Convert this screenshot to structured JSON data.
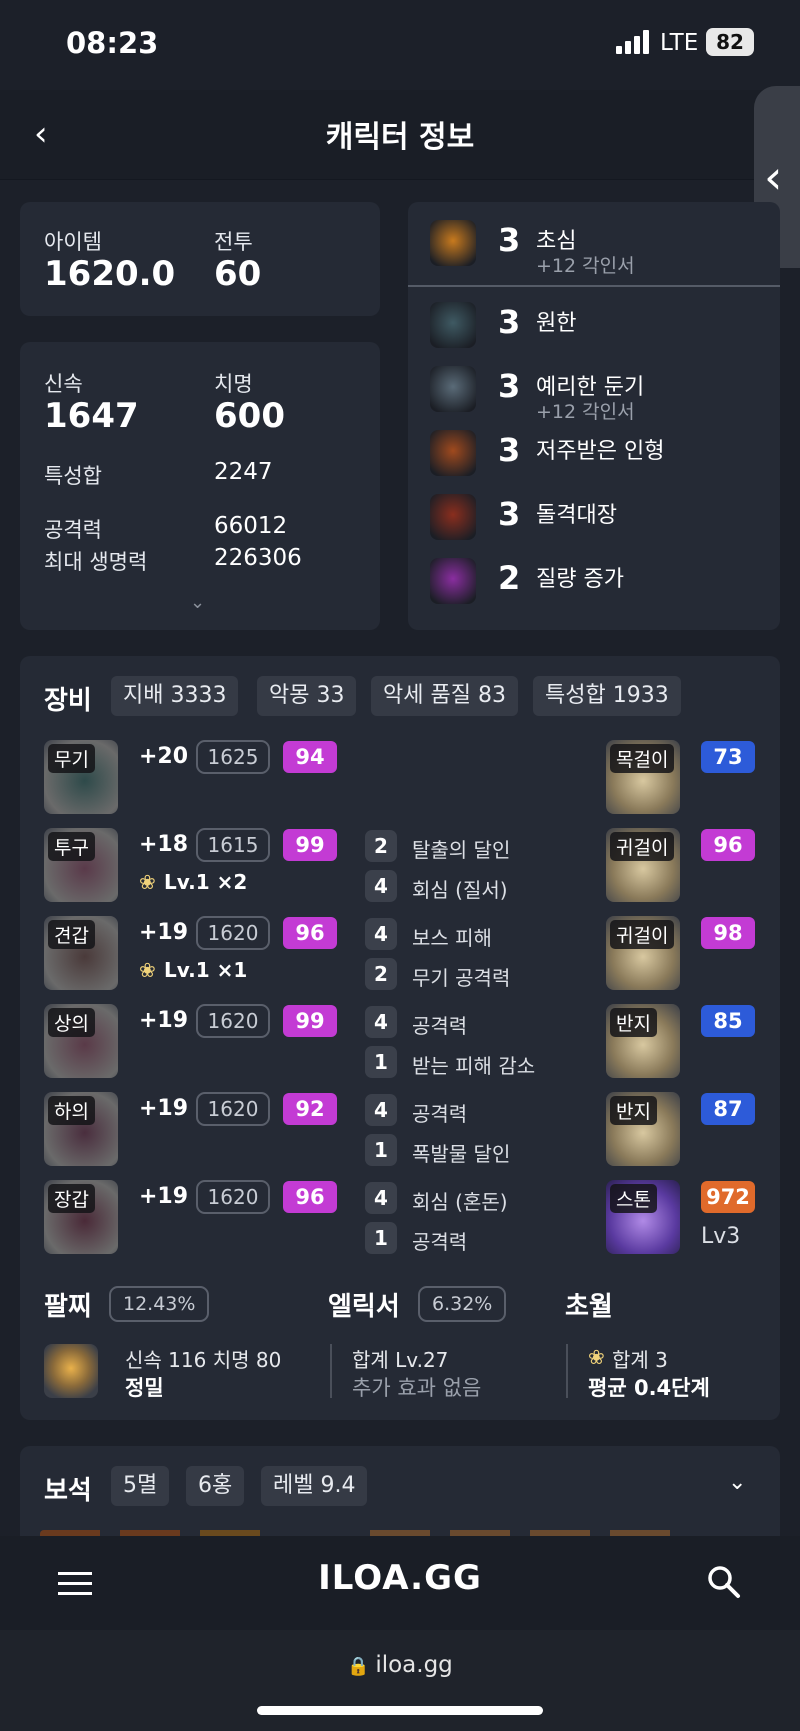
{
  "status": {
    "time": "08:23",
    "network": "LTE",
    "battery": "82"
  },
  "header": {
    "title": "캐릭터 정보"
  },
  "summary": {
    "item_label": "아이템",
    "item_value": "1620.0",
    "combat_label": "전투",
    "combat_value": "60"
  },
  "stats": {
    "speed_label": "신속",
    "speed_value": "1647",
    "crit_label": "치명",
    "crit_value": "600",
    "trait_sum_label": "특성합",
    "trait_sum_value": "2247",
    "attack_label": "공격력",
    "attack_value": "66012",
    "hp_label": "최대 생명력",
    "hp_value": "226306"
  },
  "engravings": [
    {
      "level": "3",
      "name": "초심",
      "sub": "+12 각인서",
      "icon": "engraving-beginner-icon",
      "color": "#c87a1e"
    },
    {
      "level": "3",
      "name": "원한",
      "sub": "",
      "icon": "engraving-grudge-icon",
      "color": "#3f5a63"
    },
    {
      "level": "3",
      "name": "예리한 둔기",
      "sub": "+12 각인서",
      "icon": "engraving-keen-blunt-icon",
      "color": "#5a6b78"
    },
    {
      "level": "3",
      "name": "저주받은 인형",
      "sub": "",
      "icon": "engraving-cursed-doll-icon",
      "color": "#a04a1e"
    },
    {
      "level": "3",
      "name": "돌격대장",
      "sub": "",
      "icon": "engraving-raid-captain-icon",
      "color": "#8a2e1e"
    },
    {
      "level": "2",
      "name": "질량 증가",
      "sub": "",
      "icon": "engraving-mass-increase-icon",
      "color": "#8a2ea0"
    }
  ],
  "equipment": {
    "title": "장비",
    "chips": [
      "지배 3333",
      "악몽 33",
      "악세 품질 83",
      "특성합 1933"
    ],
    "gear": [
      {
        "slot": "무기",
        "plus": "+20",
        "ilvl": "1625",
        "quality": "94",
        "elixir": "",
        "color": "#2e4a4a",
        "opts": []
      },
      {
        "slot": "투구",
        "plus": "+18",
        "ilvl": "1615",
        "quality": "99",
        "elixir": "Lv.1  ×2",
        "color": "#5a3a4a",
        "opts": [
          {
            "n": "2",
            "t": "탈출의 달인"
          },
          {
            "n": "4",
            "t": "회심 (질서)"
          }
        ]
      },
      {
        "slot": "견갑",
        "plus": "+19",
        "ilvl": "1620",
        "quality": "96",
        "elixir": "Lv.1  ×1",
        "color": "#4a3a3a",
        "opts": [
          {
            "n": "4",
            "t": "보스 피해"
          },
          {
            "n": "2",
            "t": "무기 공격력"
          }
        ]
      },
      {
        "slot": "상의",
        "plus": "+19",
        "ilvl": "1620",
        "quality": "99",
        "elixir": "",
        "color": "#5a3a48",
        "opts": [
          {
            "n": "4",
            "t": "공격력"
          },
          {
            "n": "1",
            "t": "받는 피해 감소"
          }
        ]
      },
      {
        "slot": "하의",
        "plus": "+19",
        "ilvl": "1620",
        "quality": "92",
        "elixir": "",
        "color": "#4a2e3e",
        "opts": [
          {
            "n": "4",
            "t": "공격력"
          },
          {
            "n": "1",
            "t": "폭발물 달인"
          }
        ]
      },
      {
        "slot": "장갑",
        "plus": "+19",
        "ilvl": "1620",
        "quality": "96",
        "elixir": "",
        "color": "#4a2a38",
        "opts": [
          {
            "n": "4",
            "t": "회심 (혼돈)"
          },
          {
            "n": "1",
            "t": "공격력"
          }
        ]
      }
    ],
    "accessories": [
      {
        "slot": "목걸이",
        "quality": "73",
        "tone": "blue"
      },
      {
        "slot": "귀걸이",
        "quality": "96",
        "tone": "pink"
      },
      {
        "slot": "귀걸이",
        "quality": "98",
        "tone": "pink"
      },
      {
        "slot": "반지",
        "quality": "85",
        "tone": "blue"
      },
      {
        "slot": "반지",
        "quality": "87",
        "tone": "blue"
      },
      {
        "slot": "스톤",
        "quality": "972",
        "tone": "orange",
        "extra": "Lv3"
      }
    ]
  },
  "bracelet": {
    "title": "팔찌",
    "pct": "12.43%",
    "line1": "신속 116   치명 80",
    "line2": "정밀"
  },
  "elixir": {
    "title": "엘릭서",
    "pct": "6.32%",
    "line1": "합계 Lv.27",
    "line2": "추가 효과 없음"
  },
  "transcend": {
    "title": "초월",
    "line1": "합계 3",
    "line2": "평균 0.4단계"
  },
  "gems": {
    "title": "보석",
    "chips": [
      "5멸",
      "6홍",
      "레벨 9.4"
    ]
  },
  "nav": {
    "logo": "ILOA.GG",
    "url": "iloa.gg"
  },
  "colors": {
    "pink": "#c33bd4",
    "blue": "#2d5bd9",
    "orange": "#e06a2b",
    "background": "#1c2029",
    "card": "#252a35"
  }
}
